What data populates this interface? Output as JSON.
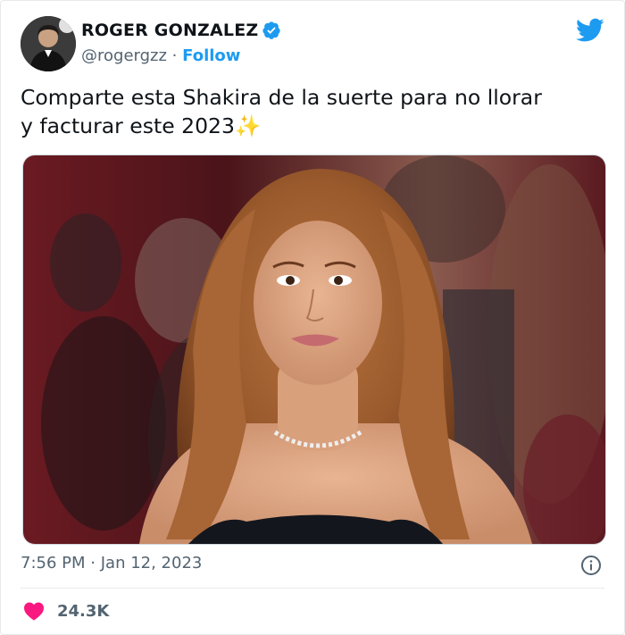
{
  "author": {
    "name": "ROGER GONZALEZ",
    "handle": "@rogergzz",
    "separator": "·",
    "follow_label": "Follow"
  },
  "tweet": {
    "text_line1": "Comparte esta Shakira de la suerte para no llorar",
    "text_line2": "y facturar este 2023",
    "emoji": "✨",
    "time": "7:56 PM",
    "date": "Jan 12, 2023",
    "likes": "24.3K"
  },
  "colors": {
    "brand_blue": "#1d9bf0",
    "heart_pink": "#f91880",
    "secondary_text": "#536471"
  },
  "icons": [
    "verified-badge-icon",
    "twitter-bird-icon",
    "info-icon",
    "heart-icon"
  ]
}
